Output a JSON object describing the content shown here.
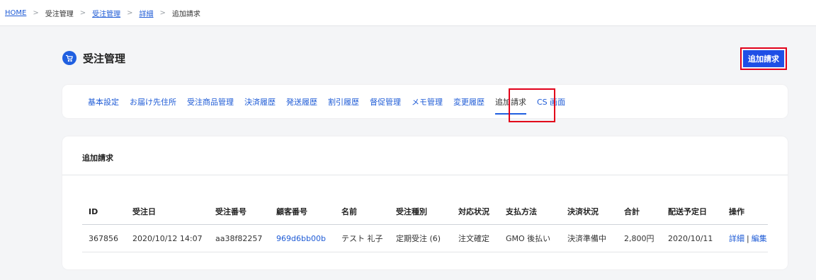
{
  "breadcrumb": {
    "home": "HOME",
    "juchu_kanri": "受注管理",
    "juchu_kanri_link": "受注管理",
    "detail": "詳細",
    "current": "追加請求",
    "separator": ">"
  },
  "header": {
    "title": "受注管理",
    "add_button": "追加請求"
  },
  "tabs": [
    {
      "label": "基本設定"
    },
    {
      "label": "お届け先住所"
    },
    {
      "label": "受注商品管理"
    },
    {
      "label": "決済履歴"
    },
    {
      "label": "発送履歴"
    },
    {
      "label": "割引履歴"
    },
    {
      "label": "督促管理"
    },
    {
      "label": "メモ管理"
    },
    {
      "label": "変更履歴"
    },
    {
      "label": "追加請求"
    },
    {
      "label": "CS 画面"
    }
  ],
  "section": {
    "title": "追加請求"
  },
  "table": {
    "headers": [
      "ID",
      "受注日",
      "受注番号",
      "顧客番号",
      "名前",
      "受注種別",
      "対応状況",
      "支払方法",
      "決済状況",
      "合計",
      "配送予定日",
      "操作"
    ],
    "rows": [
      {
        "id": "367856",
        "order_date": "2020/10/12 14:07",
        "order_no": "aa38f82257",
        "customer_no": "969d6bb00b",
        "name": "テスト 礼子",
        "order_type": "定期受注 (6)",
        "status": "注文確定",
        "payment_method": "GMO 後払い",
        "payment_status": "決済準備中",
        "total": "2,800円",
        "delivery_date": "2020/10/11",
        "op_detail": "詳細",
        "op_sep": "|",
        "op_edit": "編集"
      }
    ]
  },
  "colors": {
    "accent": "#1f5fe0",
    "link": "#1e5bd6",
    "highlight": "#e2001a"
  }
}
